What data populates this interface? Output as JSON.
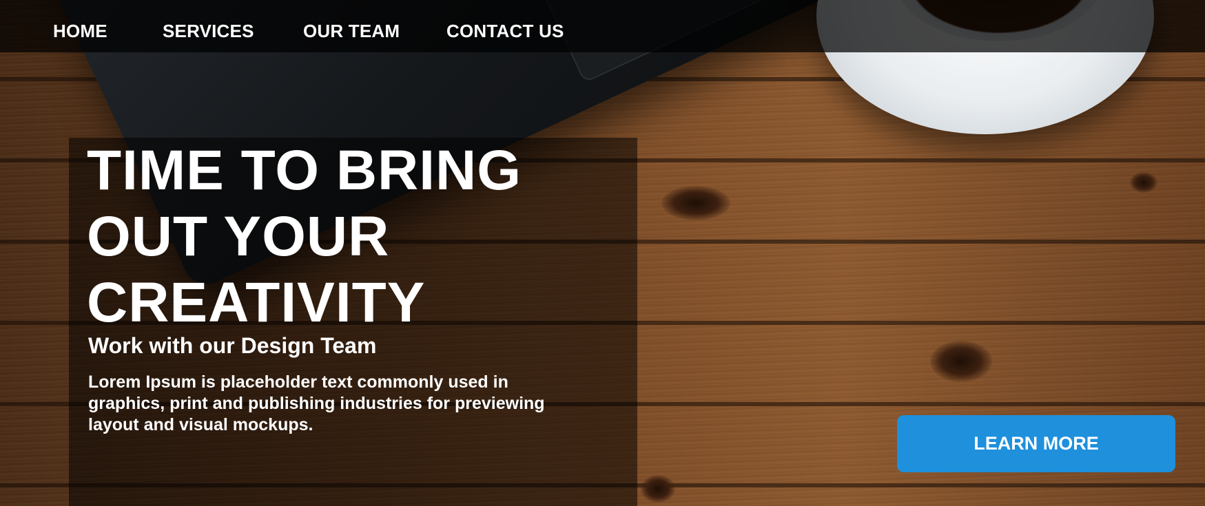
{
  "nav": {
    "items": [
      {
        "label": "HOME"
      },
      {
        "label": "SERVICES"
      },
      {
        "label": "OUR TEAM"
      },
      {
        "label": "CONTACT US"
      }
    ]
  },
  "hero": {
    "headline_lines": [
      "TIME TO BRING",
      "OUT YOUR",
      "CREATIVITY"
    ],
    "subheading": "Work with our Design Team",
    "body": "Lorem Ipsum is placeholder text commonly used in graphics, print and publishing industries for previewing layout and visual mockups.",
    "cta_label": "LEARN MORE"
  },
  "colors": {
    "cta_background": "#1e90dc",
    "nav_bar": "#000000",
    "text": "#ffffff"
  }
}
